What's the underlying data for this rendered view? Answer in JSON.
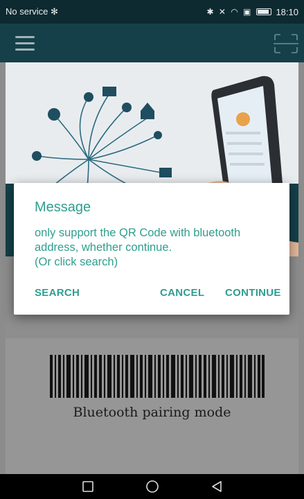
{
  "status_bar": {
    "carrier": "No service",
    "time": "18:10",
    "icons": [
      "bluetooth-icon",
      "mute-icon",
      "wifi-icon",
      "nfc-icon",
      "battery-icon"
    ]
  },
  "toolbar": {
    "menu_icon": "hamburger-menu-icon",
    "scan_icon": "scan-qr-icon"
  },
  "dialog": {
    "title": "Message",
    "message_line1": "only support the QR Code with bluetooth address, whether continue.",
    "message_line2": "(Or click search)",
    "buttons": {
      "search": "SEARCH",
      "cancel": "CANCEL",
      "continue": "CONTINUE"
    },
    "accent_color": "#2f9e8e"
  },
  "barcode": {
    "caption": "Bluetooth pairing mode"
  },
  "nav_bar": {
    "buttons": [
      "recents-square-icon",
      "home-circle-icon",
      "back-triangle-icon"
    ]
  }
}
